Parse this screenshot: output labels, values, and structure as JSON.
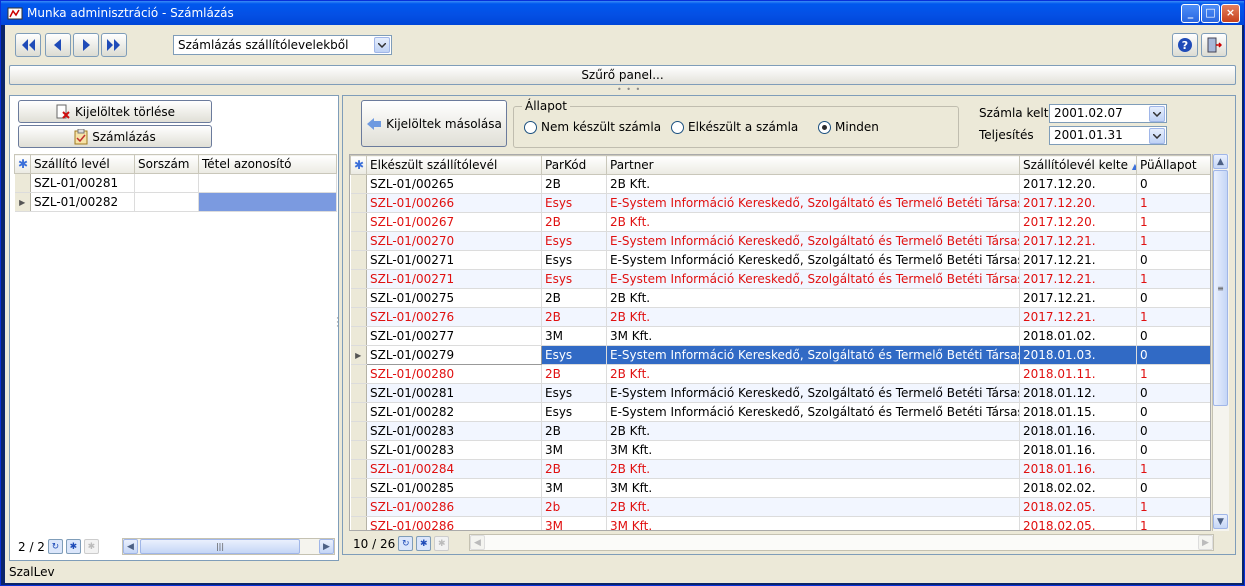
{
  "window": {
    "title": "Munka adminisztráció - Számlázás"
  },
  "toolbar": {
    "mode_select_value": "Számlázás szállítólevelekből",
    "filter_panel_label": "Szűrő panel..."
  },
  "left": {
    "delete_button_label": "Kijelöltek törlése",
    "invoice_button_label": "Számlázás",
    "columns": [
      "Szállító levél",
      "Sorszám",
      "Tétel azonosító"
    ],
    "rows": [
      {
        "szallito": "SZL-01/00281",
        "sorszam": "",
        "tetel": ""
      },
      {
        "szallito": "SZL-01/00282",
        "sorszam": "",
        "tetel": ""
      }
    ],
    "pager_text": "2 / 2"
  },
  "right": {
    "copy_button_label": "Kijelöltek másolása",
    "status_group": {
      "legend": "Állapot",
      "options": [
        "Nem készült számla",
        "Elkészült a számla",
        "Minden"
      ],
      "selected": "Minden"
    },
    "invoice_date_label": "Számla kelte",
    "invoice_date_value": "2001.02.07",
    "fulfillment_label": "Teljesítés",
    "fulfillment_value": "2001.01.31",
    "columns": [
      "Elkészült szállítólevél",
      "ParKód",
      "Partner",
      "Szállítólevél kelte",
      "PüÁllapot"
    ],
    "sort_indicator": "▲",
    "rows": [
      {
        "level": "SZL-01/00265",
        "parkod": "2B",
        "partner": "2B Kft.",
        "kelte": "2017.12.20.",
        "allapot": "0"
      },
      {
        "level": "SZL-01/00266",
        "parkod": "Esys",
        "partner": "E-System Információ Kereskedő, Szolgáltató és Termelő Betéti Társaság",
        "kelte": "2017.12.20.",
        "allapot": "1"
      },
      {
        "level": "SZL-01/00267",
        "parkod": "2B",
        "partner": "2B Kft.",
        "kelte": "2017.12.20.",
        "allapot": "1"
      },
      {
        "level": "SZL-01/00270",
        "parkod": "Esys",
        "partner": "E-System Információ Kereskedő, Szolgáltató és Termelő Betéti Társaság",
        "kelte": "2017.12.21.",
        "allapot": "1"
      },
      {
        "level": "SZL-01/00271",
        "parkod": "Esys",
        "partner": "E-System Információ Kereskedő, Szolgáltató és Termelő Betéti Társaság",
        "kelte": "2017.12.21.",
        "allapot": "0"
      },
      {
        "level": "SZL-01/00271",
        "parkod": "Esys",
        "partner": "E-System Információ Kereskedő, Szolgáltató és Termelő Betéti Társaság",
        "kelte": "2017.12.21.",
        "allapot": "1"
      },
      {
        "level": "SZL-01/00275",
        "parkod": "2B",
        "partner": "2B Kft.",
        "kelte": "2017.12.21.",
        "allapot": "0"
      },
      {
        "level": "SZL-01/00276",
        "parkod": "2B",
        "partner": "2B Kft.",
        "kelte": "2017.12.21.",
        "allapot": "1"
      },
      {
        "level": "SZL-01/00277",
        "parkod": "3M",
        "partner": "3M Kft.",
        "kelte": "2018.01.02.",
        "allapot": "0"
      },
      {
        "level": "SZL-01/00279",
        "parkod": "Esys",
        "partner": "E-System Információ Kereskedő, Szolgáltató és Termelő Betéti Társaság",
        "kelte": "2018.01.03.",
        "allapot": "0"
      },
      {
        "level": "SZL-01/00280",
        "parkod": "2B",
        "partner": "2B Kft.",
        "kelte": "2018.01.11.",
        "allapot": "1"
      },
      {
        "level": "SZL-01/00281",
        "parkod": "Esys",
        "partner": "E-System Információ Kereskedő, Szolgáltató és Termelő Betéti Társaság",
        "kelte": "2018.01.12.",
        "allapot": "0"
      },
      {
        "level": "SZL-01/00282",
        "parkod": "Esys",
        "partner": "E-System Információ Kereskedő, Szolgáltató és Termelő Betéti Társaság",
        "kelte": "2018.01.15.",
        "allapot": "0"
      },
      {
        "level": "SZL-01/00283",
        "parkod": "2B",
        "partner": "2B Kft.",
        "kelte": "2018.01.16.",
        "allapot": "0"
      },
      {
        "level": "SZL-01/00283",
        "parkod": "3M",
        "partner": "3M Kft.",
        "kelte": "2018.01.16.",
        "allapot": "0"
      },
      {
        "level": "SZL-01/00284",
        "parkod": "2B",
        "partner": "2B Kft.",
        "kelte": "2018.01.16.",
        "allapot": "1"
      },
      {
        "level": "SZL-01/00285",
        "parkod": "3M",
        "partner": "3M Kft.",
        "kelte": "2018.02.02.",
        "allapot": "0"
      },
      {
        "level": "SZL-01/00286",
        "parkod": "2b",
        "partner": "2B Kft.",
        "kelte": "2018.02.05.",
        "allapot": "1"
      },
      {
        "level": "SZL-01/00286",
        "parkod": "3M",
        "partner": "3M Kft.",
        "kelte": "2018.02.05.",
        "allapot": "1"
      }
    ],
    "selected_row_index": 9,
    "pager_text": "10 / 26"
  },
  "statusbar": {
    "text": "SzalLev"
  },
  "colors": {
    "selected_row": "#316ac5",
    "invoiced_text": "#e01010",
    "title_bar": "#0054e3"
  }
}
